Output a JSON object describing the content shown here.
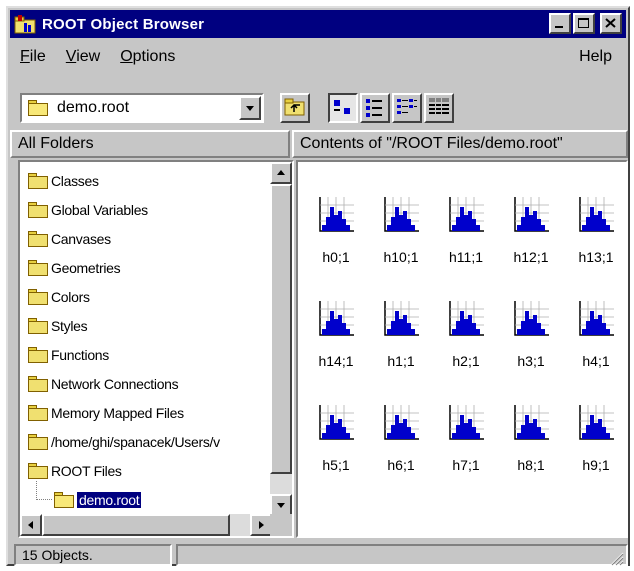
{
  "window": {
    "title": "ROOT Object Browser"
  },
  "menubar": {
    "file_first": "F",
    "file_rest": "ile",
    "view_first": "V",
    "view_rest": "iew",
    "options_first": "O",
    "options_rest": "ptions",
    "help": "Help"
  },
  "toolbar": {
    "location_value": "demo.root",
    "buttons": [
      "up-one-level-icon",
      "large-icons-view-icon",
      "small-icons-view-icon",
      "list-view-icon",
      "details-view-icon"
    ],
    "active_view": "large-icons"
  },
  "folders_pane": {
    "header": "All Folders",
    "items": [
      "Classes",
      "Global Variables",
      "Canvases",
      "Geometries",
      "Colors",
      "Styles",
      "Functions",
      "Network Connections",
      "Memory Mapped Files",
      "/home/ghi/spanacek/Users/v",
      "ROOT Files",
      "demo.root"
    ],
    "selected": "demo.root"
  },
  "contents_pane": {
    "header": "Contents of \"/ROOT Files/demo.root\"",
    "objects": [
      "h0;1",
      "h10;1",
      "h11;1",
      "h12;1",
      "h13;1",
      "h14;1",
      "h1;1",
      "h2;1",
      "h3;1",
      "h4;1",
      "h5;1",
      "h6;1",
      "h7;1",
      "h8;1",
      "h9;1"
    ],
    "icon": "histogram-icon"
  },
  "statusbar": {
    "count": "15 Objects."
  },
  "colors": {
    "titlebar": "#000080",
    "face": "#c6c6c6",
    "selection": "#000080",
    "histogram": "#0000cc"
  }
}
